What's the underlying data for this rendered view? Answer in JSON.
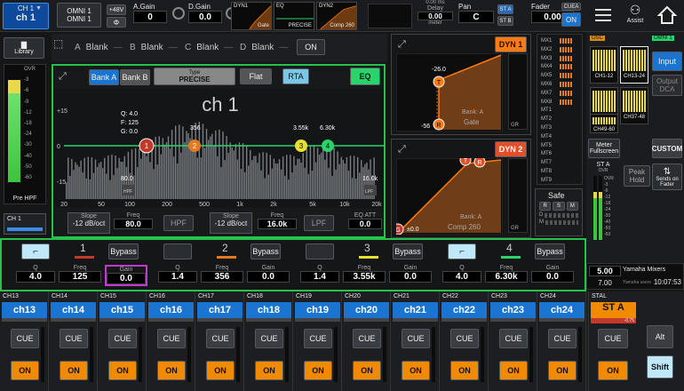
{
  "top": {
    "channel_label": "CH 1",
    "channel_name": "ch 1",
    "input_patch_1": "OMNI 1",
    "input_patch_2": "OMNI 1",
    "phantom": "+48V",
    "phase": "Φ",
    "again_label": "A.Gain",
    "again_value": "0",
    "dgain_label": "D.Gain",
    "dgain_value": "0.0",
    "dgain_sub": "D/A",
    "dyn1_label": "DYN1",
    "gate_label": "Gate",
    "eq_label": "EQ",
    "precise_label": "PRECISE",
    "dyn2_label": "DYN2",
    "comp_label": "Comp 260",
    "delay_top": "0.00 ms",
    "delay_label": "Delay",
    "delay_value": "0.00",
    "delay_unit": "meter",
    "pan_label": "Pan",
    "pan_value": "C",
    "st_a": "ST A",
    "st_b": "ST B",
    "fader_label": "Fader",
    "fader_value": "0.00",
    "cuea": "CUEA",
    "on": "ON",
    "assist": "Assist"
  },
  "left": {
    "library": "Library",
    "pre_hpf": "Pre HPF",
    "ovr": "OVR",
    "ch_bottom": "CH 1",
    "scale": [
      "OVR",
      "-3",
      "-6",
      "-9",
      "-12",
      "-18",
      "-24",
      "-30",
      "-40",
      "-50",
      "-60"
    ]
  },
  "insert": {
    "slots": [
      "A",
      "B",
      "C",
      "D"
    ],
    "blank": "Blank",
    "on": "ON"
  },
  "eq": {
    "bank_a": "Bank A",
    "bank_b": "Bank B",
    "type_label": "Type",
    "type_value": "PRECISE",
    "flat": "Flat",
    "rta": "RTA",
    "eq_on": "EQ",
    "title": "ch 1",
    "q_readout": "Q: 4.0",
    "f_readout": "F: 125",
    "g_readout": "G: 0.0",
    "lbl_356": "356",
    "lbl_355k": "3.55k",
    "lbl_630k": "6.30k",
    "lbl_80": "80.0",
    "lbl_16k": "16.0k",
    "hpf_in": "HPF",
    "lpf_in": "LPF",
    "y_labels": [
      "+15",
      "0",
      "-15"
    ],
    "x_labels": [
      "20",
      "50",
      "100",
      "200",
      "500",
      "1k",
      "2k",
      "5k",
      "10k",
      "20k"
    ],
    "slope_label": "Slope",
    "hpf_slope": "-12 dB/oct",
    "freq_label": "Freq",
    "hpf_freq": "80.0",
    "hpf_btn": "HPF",
    "lpf_slope": "-12 dB/oct",
    "lpf_freq": "16.0k",
    "lpf_btn": "LPF",
    "eq_att_label": "EQ ATT",
    "eq_att": "0.0"
  },
  "dyn": {
    "dyn1": "DYN 1",
    "dyn2": "DYN 2",
    "bank_a": "Bank: A",
    "gate": "Gate",
    "comp": "Comp 260",
    "v_neg26": "-26.0",
    "v_neg56": "-56",
    "gr": "GR",
    "in": "IN",
    "pm0": "±0.0",
    "safe": "Safe",
    "safe_btns": [
      "R",
      "S",
      "M"
    ],
    "safe_rows": [
      "D",
      "M"
    ]
  },
  "bands": [
    {
      "num": "1",
      "q": "4.0",
      "freq": "125",
      "gain": "0.0"
    },
    {
      "num": "2",
      "q": "1.4",
      "freq": "356",
      "gain": "0.0"
    },
    {
      "num": "3",
      "q": "1.4",
      "freq": "3.55k",
      "gain": "0.0"
    },
    {
      "num": "4",
      "q": "4.0",
      "freq": "6.30k",
      "gain": "0.0"
    }
  ],
  "band_labels": {
    "q": "Q",
    "freq": "Freq",
    "gain": "Gain",
    "bypass": "Bypass"
  },
  "right": {
    "mixes": [
      "MX1",
      "MX2",
      "MX3",
      "MX4",
      "MX5",
      "MX6",
      "MX7",
      "MX8",
      "MT1",
      "MT2",
      "MT3",
      "MT4",
      "MT5",
      "MT6",
      "MT7",
      "MT8",
      "MT9"
    ],
    "osc": "OSC",
    "omni": "OMNI 1",
    "banks": [
      "CH1-12",
      "CH13-24",
      "CH25-36",
      "CH37-48",
      "CH49-60"
    ],
    "input": "Input",
    "output_dca": "Output DCA",
    "meter_full": "Meter Fullscreen",
    "custom": "CUSTOM",
    "peak_hold": "Peak Hold",
    "sends": "Sends on Fader",
    "st_a": "ST A",
    "st_a_sub": "OVR",
    "level1": "5.00",
    "level2": "7.00",
    "yamaha": "Yamaha Mixers",
    "yamaha_sub": "Yamaha users",
    "clock": "10:07:53",
    "scale": [
      "OVR",
      "-3",
      "-6",
      "-12",
      "-18",
      "-24",
      "-30",
      "-40",
      "-50",
      "-60"
    ]
  },
  "strips": [
    {
      "id": "CH13",
      "name": "ch13"
    },
    {
      "id": "CH14",
      "name": "ch14"
    },
    {
      "id": "CH15",
      "name": "ch15"
    },
    {
      "id": "CH16",
      "name": "ch16"
    },
    {
      "id": "CH17",
      "name": "ch17"
    },
    {
      "id": "CH18",
      "name": "ch18"
    },
    {
      "id": "CH19",
      "name": "ch19"
    },
    {
      "id": "CH20",
      "name": "ch20"
    },
    {
      "id": "CH21",
      "name": "ch21"
    },
    {
      "id": "CH22",
      "name": "ch22"
    },
    {
      "id": "CH23",
      "name": "ch23"
    },
    {
      "id": "CH24",
      "name": "ch24"
    }
  ],
  "stal": {
    "id": "STAL",
    "name": "ST A",
    "value": "-0.75"
  },
  "strip_labels": {
    "cue": "CUE",
    "on": "ON"
  },
  "bottom_right": {
    "alt": "Alt",
    "shift": "Shift"
  },
  "colors": {
    "accent_green": "#27c24c",
    "on_orange": "#f08a00",
    "blue": "#1b75d0",
    "dyn_orange": "#ff7a10",
    "eq_green": "#2ad46b"
  }
}
